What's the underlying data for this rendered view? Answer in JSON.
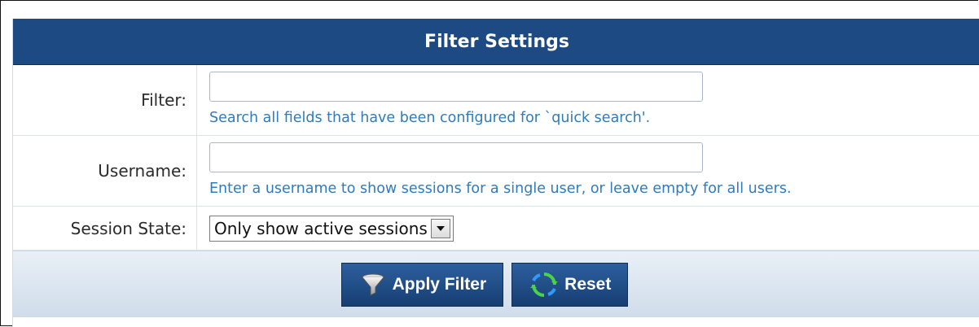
{
  "header": {
    "title": "Filter Settings"
  },
  "fields": {
    "filter": {
      "label": "Filter:",
      "value": "",
      "hint": "Search all fields that have been configured for `quick search'."
    },
    "username": {
      "label": "Username:",
      "value": "",
      "hint": "Enter a username to show sessions for a single user, or leave empty for all users."
    },
    "session_state": {
      "label": "Session State:",
      "selected": "Only show active sessions"
    }
  },
  "actions": {
    "apply_label": "Apply Filter",
    "reset_label": "Reset",
    "apply_icon": "funnel-icon",
    "reset_icon": "refresh-icon"
  },
  "colors": {
    "header_bg": "#1d4a82",
    "hint_text": "#2f7bbd",
    "button_bg": "#1d4a82"
  }
}
